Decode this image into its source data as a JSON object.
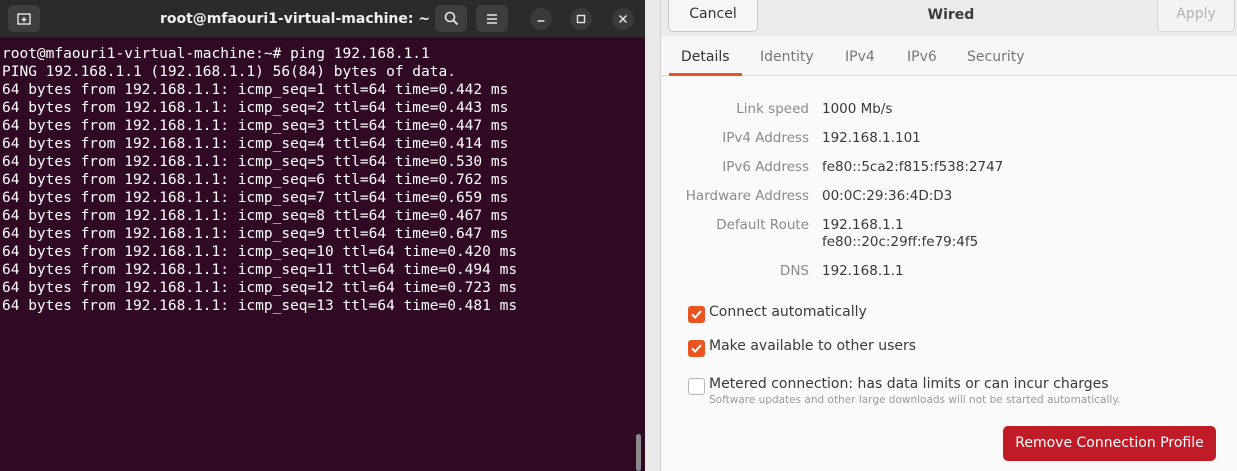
{
  "terminal": {
    "title": "root@mfaouri1-virtual-machine: ~",
    "lines": [
      "root@mfaouri1-virtual-machine:~# ping 192.168.1.1",
      "PING 192.168.1.1 (192.168.1.1) 56(84) bytes of data.",
      "64 bytes from 192.168.1.1: icmp_seq=1 ttl=64 time=0.442 ms",
      "64 bytes from 192.168.1.1: icmp_seq=2 ttl=64 time=0.443 ms",
      "64 bytes from 192.168.1.1: icmp_seq=3 ttl=64 time=0.447 ms",
      "64 bytes from 192.168.1.1: icmp_seq=4 ttl=64 time=0.414 ms",
      "64 bytes from 192.168.1.1: icmp_seq=5 ttl=64 time=0.530 ms",
      "64 bytes from 192.168.1.1: icmp_seq=6 ttl=64 time=0.762 ms",
      "64 bytes from 192.168.1.1: icmp_seq=7 ttl=64 time=0.659 ms",
      "64 bytes from 192.168.1.1: icmp_seq=8 ttl=64 time=0.467 ms",
      "64 bytes from 192.168.1.1: icmp_seq=9 ttl=64 time=0.647 ms",
      "64 bytes from 192.168.1.1: icmp_seq=10 ttl=64 time=0.420 ms",
      "64 bytes from 192.168.1.1: icmp_seq=11 ttl=64 time=0.494 ms",
      "64 bytes from 192.168.1.1: icmp_seq=12 ttl=64 time=0.723 ms",
      "64 bytes from 192.168.1.1: icmp_seq=13 ttl=64 time=0.481 ms"
    ],
    "icons": {
      "new_tab": "new-tab-icon",
      "search": "search-icon",
      "menu": "hamburger-menu-icon",
      "minimize": "minimize-icon",
      "maximize": "maximize-icon",
      "close": "close-icon"
    },
    "colors": {
      "background": "#300a24",
      "text": "#ffffff",
      "header": "#2b2b2b"
    }
  },
  "dialog": {
    "title": "Wired",
    "cancel_label": "Cancel",
    "apply_label": "Apply",
    "tabs": [
      {
        "label": "Details",
        "active": true
      },
      {
        "label": "Identity",
        "active": false
      },
      {
        "label": "IPv4",
        "active": false
      },
      {
        "label": "IPv6",
        "active": false
      },
      {
        "label": "Security",
        "active": false
      }
    ],
    "details": {
      "link_speed": {
        "label": "Link speed",
        "value": "1000 Mb/s"
      },
      "ipv4": {
        "label": "IPv4 Address",
        "value": "192.168.1.101"
      },
      "ipv6": {
        "label": "IPv6 Address",
        "value": "fe80::5ca2:f815:f538:2747"
      },
      "hardware": {
        "label": "Hardware Address",
        "value": "00:0C:29:36:4D:D3"
      },
      "default_route": {
        "label": "Default Route",
        "value": "192.168.1.1",
        "value2": "fe80::20c:29ff:fe79:4f5"
      },
      "dns": {
        "label": "DNS",
        "value": "192.168.1.1"
      }
    },
    "options": {
      "connect_auto": {
        "label": "Connect automatically",
        "checked": true
      },
      "available_users": {
        "label": "Make available to other users",
        "checked": true
      },
      "metered": {
        "label": "Metered connection: has data limits or can incur charges",
        "sublabel": "Software updates and other large downloads will not be started automatically.",
        "checked": false
      }
    },
    "remove_label": "Remove Connection Profile",
    "colors": {
      "accent": "#e95420",
      "destructive": "#c01c28"
    }
  }
}
